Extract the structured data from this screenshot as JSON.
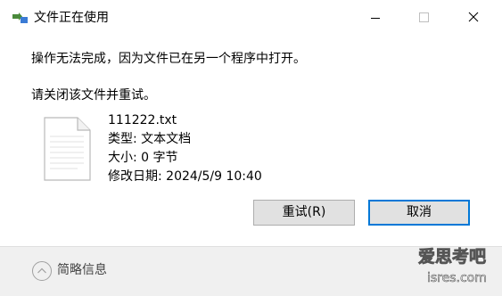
{
  "window": {
    "title": "文件正在使用",
    "minimize_label": "",
    "maximize_label": "",
    "close_label": ""
  },
  "message": {
    "line1": "操作无法完成，因为文件已在另一个程序中打开。",
    "line2": "请关闭该文件并重试。"
  },
  "file": {
    "icon": "file-icon",
    "name": "111222.txt",
    "type": "类型: 文本文档",
    "size": "大小: 0 字节",
    "modified": "修改日期: 2024/5/9 10:40"
  },
  "buttons": {
    "retry": "重试(R)",
    "cancel": "取消"
  },
  "footer": {
    "details": "简略信息"
  },
  "watermark": {
    "line1": "爱思考吧",
    "line2": "isres.com"
  },
  "colors": {
    "accent": "#0078d7",
    "button_bg": "#e1e1e1",
    "footer_bg": "#f0f0f0"
  }
}
